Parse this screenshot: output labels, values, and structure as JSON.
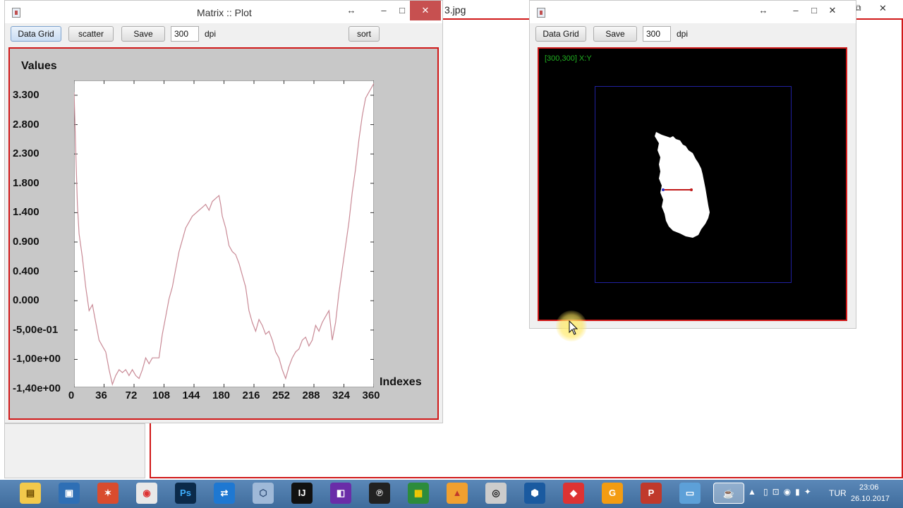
{
  "background": {
    "tab_text": "3.jpg"
  },
  "plot_window": {
    "title": "Matrix :: Plot",
    "buttons": {
      "data_grid": "Data Grid",
      "scatter": "scatter",
      "save": "Save",
      "sort": "sort"
    },
    "dpi_value": "300",
    "dpi_label": "dpi",
    "controls": {
      "resize": "↔",
      "minimize": "–",
      "maximize": "□",
      "close": "✕"
    }
  },
  "chart_data": {
    "type": "line",
    "title": "",
    "ylabel": "Values",
    "xlabel": "Indexes",
    "xlim": [
      0,
      360
    ],
    "ylim": [
      -1.4,
      3.8
    ],
    "y_ticks": [
      "3.300",
      "2.800",
      "2.300",
      "1.800",
      "1.400",
      "0.900",
      "0.400",
      "0.000",
      "-5,00e-01",
      "-1,00e+00",
      "-1,40e+00"
    ],
    "x_ticks": [
      "0",
      "36",
      "72",
      "108",
      "144",
      "180",
      "216",
      "252",
      "288",
      "324",
      "360"
    ],
    "line_color": "#c98a96",
    "series": [
      {
        "x": [
          0,
          2,
          4,
          6,
          10,
          14,
          18,
          22,
          26,
          30,
          34,
          38,
          42,
          46,
          50,
          54,
          58,
          62,
          66,
          70,
          74,
          78,
          82,
          86,
          90,
          94,
          98,
          102,
          106,
          110,
          114,
          118,
          122,
          126,
          130,
          134,
          138,
          142,
          146,
          150,
          154,
          158,
          162,
          166,
          170,
          174,
          176,
          178,
          182,
          186,
          190,
          194,
          198,
          202,
          206,
          210,
          214,
          218,
          222,
          226,
          230,
          234,
          238,
          242,
          246,
          250,
          254,
          258,
          262,
          266,
          270,
          274,
          278,
          282,
          286,
          290,
          294,
          298,
          302,
          306,
          310,
          314,
          318,
          322,
          326,
          330,
          334,
          338,
          342,
          346,
          350,
          354,
          358,
          360
        ],
        "y": [
          3.6,
          2.6,
          1.7,
          1.2,
          0.8,
          0.3,
          -0.1,
          0.0,
          -0.3,
          -0.6,
          -0.7,
          -0.8,
          -1.1,
          -1.35,
          -1.2,
          -1.1,
          -1.15,
          -1.1,
          -1.2,
          -1.1,
          -1.2,
          -1.25,
          -1.1,
          -0.9,
          -1.0,
          -0.9,
          -0.9,
          -0.9,
          -0.5,
          -0.2,
          0.1,
          0.3,
          0.6,
          0.9,
          1.1,
          1.3,
          1.4,
          1.5,
          1.55,
          1.6,
          1.65,
          1.7,
          1.6,
          1.75,
          1.8,
          1.85,
          1.7,
          1.5,
          1.3,
          1.0,
          0.9,
          0.85,
          0.7,
          0.5,
          0.3,
          -0.1,
          -0.3,
          -0.45,
          -0.25,
          -0.35,
          -0.5,
          -0.45,
          -0.6,
          -0.8,
          -0.9,
          -1.1,
          -1.25,
          -1.05,
          -0.9,
          -0.8,
          -0.75,
          -0.6,
          -0.55,
          -0.7,
          -0.6,
          -0.35,
          -0.45,
          -0.3,
          -0.2,
          -0.1,
          -0.6,
          -0.3,
          0.2,
          0.6,
          1.0,
          1.4,
          1.9,
          2.3,
          2.8,
          3.2,
          3.5,
          3.6,
          3.7,
          3.75
        ]
      }
    ]
  },
  "image_window": {
    "buttons": {
      "data_grid": "Data Grid",
      "save": "Save"
    },
    "dpi_value": "300",
    "dpi_label": "dpi",
    "coord_readout": "[300,300] X:Y",
    "controls": {
      "resize": "↔",
      "minimize": "–",
      "maximize": "□",
      "close": "✕"
    }
  },
  "taskbar": {
    "apps": [
      "file-explorer",
      "remote-desktop",
      "steam",
      "chrome",
      "Ps",
      "teamviewer",
      "box-app",
      "IJ",
      "visual-studio",
      "p-app",
      "office",
      "matlab",
      "camera",
      "virtualbox",
      "sketchup",
      "g-pdf",
      "P",
      "photo-viewer",
      "java"
    ],
    "app_labels": {
      "ps": "Ps",
      "ij": "IJ",
      "p": "P",
      "pp": "P"
    },
    "language": "TUR",
    "time": "23:06",
    "date": "26.10.2017"
  },
  "colors": {
    "red_border": "#d01818",
    "taskbar_bg": "#4a78a8",
    "roi_blue": "#2020a0",
    "coord_green": "#20b020"
  }
}
